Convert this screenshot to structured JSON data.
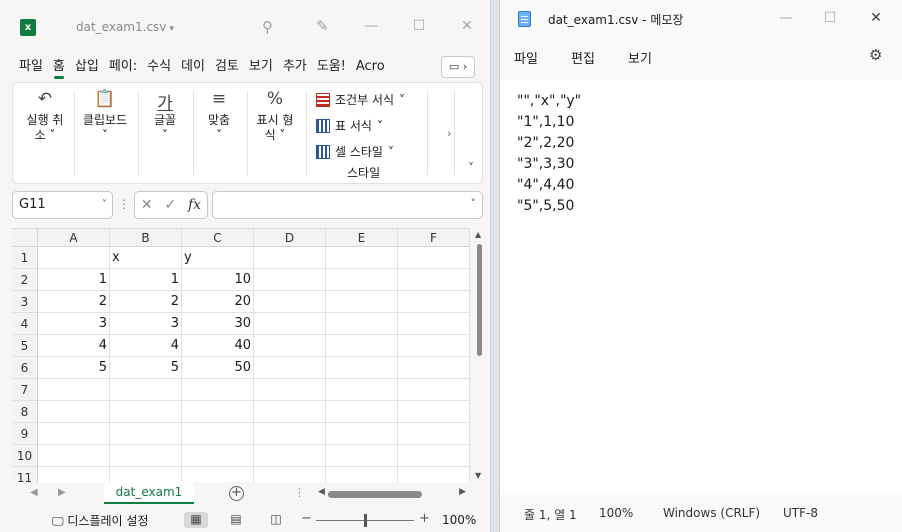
{
  "excel": {
    "logo": "x",
    "filename": "dat_exam1.csv",
    "filename_caret": "▾",
    "tabs": [
      "파일",
      "홈",
      "삽입",
      "페이:",
      "수식",
      "데이",
      "검토",
      "보기",
      "추가",
      "도움!",
      "Acro"
    ],
    "active_tab": "홈",
    "ribbon": {
      "undo_label1": "실행 취",
      "undo_label2": "소",
      "clipboard_label": "클립보드",
      "font_label": "글꼴",
      "font_icon": "가",
      "align_label": "맞춤",
      "number_label1": "표시 형",
      "number_label2": "식",
      "number_icon": "%",
      "conditional": "조건부 서식",
      "table_format": "표 서식",
      "cell_style": "셀 스타일",
      "style_group": "스타일"
    },
    "namebox": "G11",
    "fx": "fx",
    "columns": [
      "A",
      "B",
      "C",
      "D",
      "E",
      "F"
    ],
    "rows": [
      [
        "",
        "x",
        "y",
        "",
        "",
        ""
      ],
      [
        "1",
        "1",
        "10",
        "",
        "",
        ""
      ],
      [
        "2",
        "2",
        "20",
        "",
        "",
        ""
      ],
      [
        "3",
        "3",
        "30",
        "",
        "",
        ""
      ],
      [
        "4",
        "4",
        "40",
        "",
        "",
        ""
      ],
      [
        "5",
        "5",
        "50",
        "",
        "",
        ""
      ],
      [
        "",
        "",
        "",
        "",
        "",
        ""
      ],
      [
        "",
        "",
        "",
        "",
        "",
        ""
      ],
      [
        "",
        "",
        "",
        "",
        "",
        ""
      ],
      [
        "",
        "",
        "",
        "",
        "",
        ""
      ],
      [
        "",
        "",
        "",
        "",
        "",
        ""
      ]
    ],
    "row_numbers": [
      "1",
      "2",
      "3",
      "4",
      "5",
      "6",
      "7",
      "8",
      "9",
      "10",
      "11"
    ],
    "sheet_tab": "dat_exam1",
    "status_display": "디스플레이 설정",
    "zoom": "100%"
  },
  "notepad": {
    "title": "dat_exam1.csv - 메모장",
    "menu": [
      "파일",
      "편집",
      "보기"
    ],
    "lines": [
      "\"\",\"x\",\"y\"",
      "\"1\",1,10",
      "\"2\",2,20",
      "\"3\",3,30",
      "\"4\",4,40",
      "\"5\",5,50"
    ],
    "status": {
      "position": "줄 1, 열 1",
      "zoom": "100%",
      "line_ending": "Windows (CRLF)",
      "encoding": "UTF-8"
    }
  },
  "colors": {
    "excel_green": "#107c41",
    "notepad_blue": "#6ab0f3"
  }
}
